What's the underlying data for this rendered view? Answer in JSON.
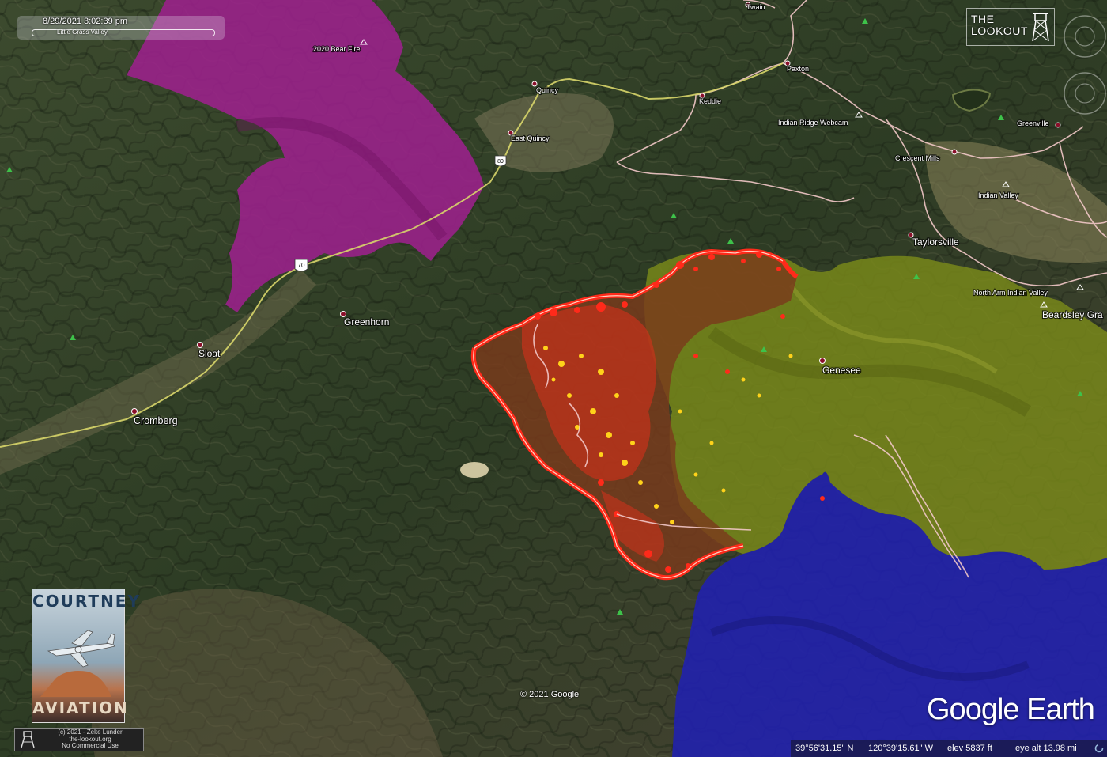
{
  "timestamp": "8/29/2021   3:02:39 pm",
  "time_panel_place": "Little Grass Valley",
  "places": [
    {
      "name": "Twain",
      "size": "sm"
    },
    {
      "name": "Paxton",
      "size": "sm"
    },
    {
      "name": "Quincy",
      "size": "sm"
    },
    {
      "name": "Keddie",
      "size": "sm"
    },
    {
      "name": "East Quincy",
      "size": "sm"
    },
    {
      "name": "Indian Ridge Webcam",
      "size": "sm"
    },
    {
      "name": "Greenville",
      "size": "sm"
    },
    {
      "name": "Crescent Mills",
      "size": "sm"
    },
    {
      "name": "Indian Valley",
      "size": "sm"
    },
    {
      "name": "Taylorsville",
      "size": "md"
    },
    {
      "name": "North Arm Indian Valley",
      "size": "sm"
    },
    {
      "name": "Beardsley Gra",
      "size": "md"
    },
    {
      "name": "Genesee",
      "size": "md"
    },
    {
      "name": "Greenhorn",
      "size": "md"
    },
    {
      "name": "Sloat",
      "size": "md"
    },
    {
      "name": "Cromberg",
      "size": "lg"
    },
    {
      "name": "2020 Bear Fire",
      "size": "sm"
    }
  ],
  "route_shields": [
    "89",
    "70"
  ],
  "lookout_logo": {
    "line1": "THE",
    "line2": "LOOKOUT"
  },
  "courtney_logo": {
    "top": "COURTNEY",
    "bottom": "AVIATION"
  },
  "credit": [
    "(c) 2021 - Zeke Lunder",
    "the-lookout.org",
    "No Commercial Use"
  ],
  "copyright": "© 2021 Google",
  "google_earth_logo": "Google Earth",
  "status": {
    "lat": "39°56'31.15\" N",
    "lon": "120°39'15.61\" W",
    "elev": "elev  5837 ft",
    "eye_alt": "eye alt  13.98 mi"
  },
  "colors": {
    "bear_fire": "#a0208f",
    "fire_old": "#7a3a1c",
    "fire_perimeter": "#ff2a1a",
    "hotspot_yellow": "#ffd21a",
    "green_area": "#7a8a1a",
    "blue_area": "#2020b0",
    "roads": "#f2c8c8",
    "highway": "#d8d66a"
  }
}
